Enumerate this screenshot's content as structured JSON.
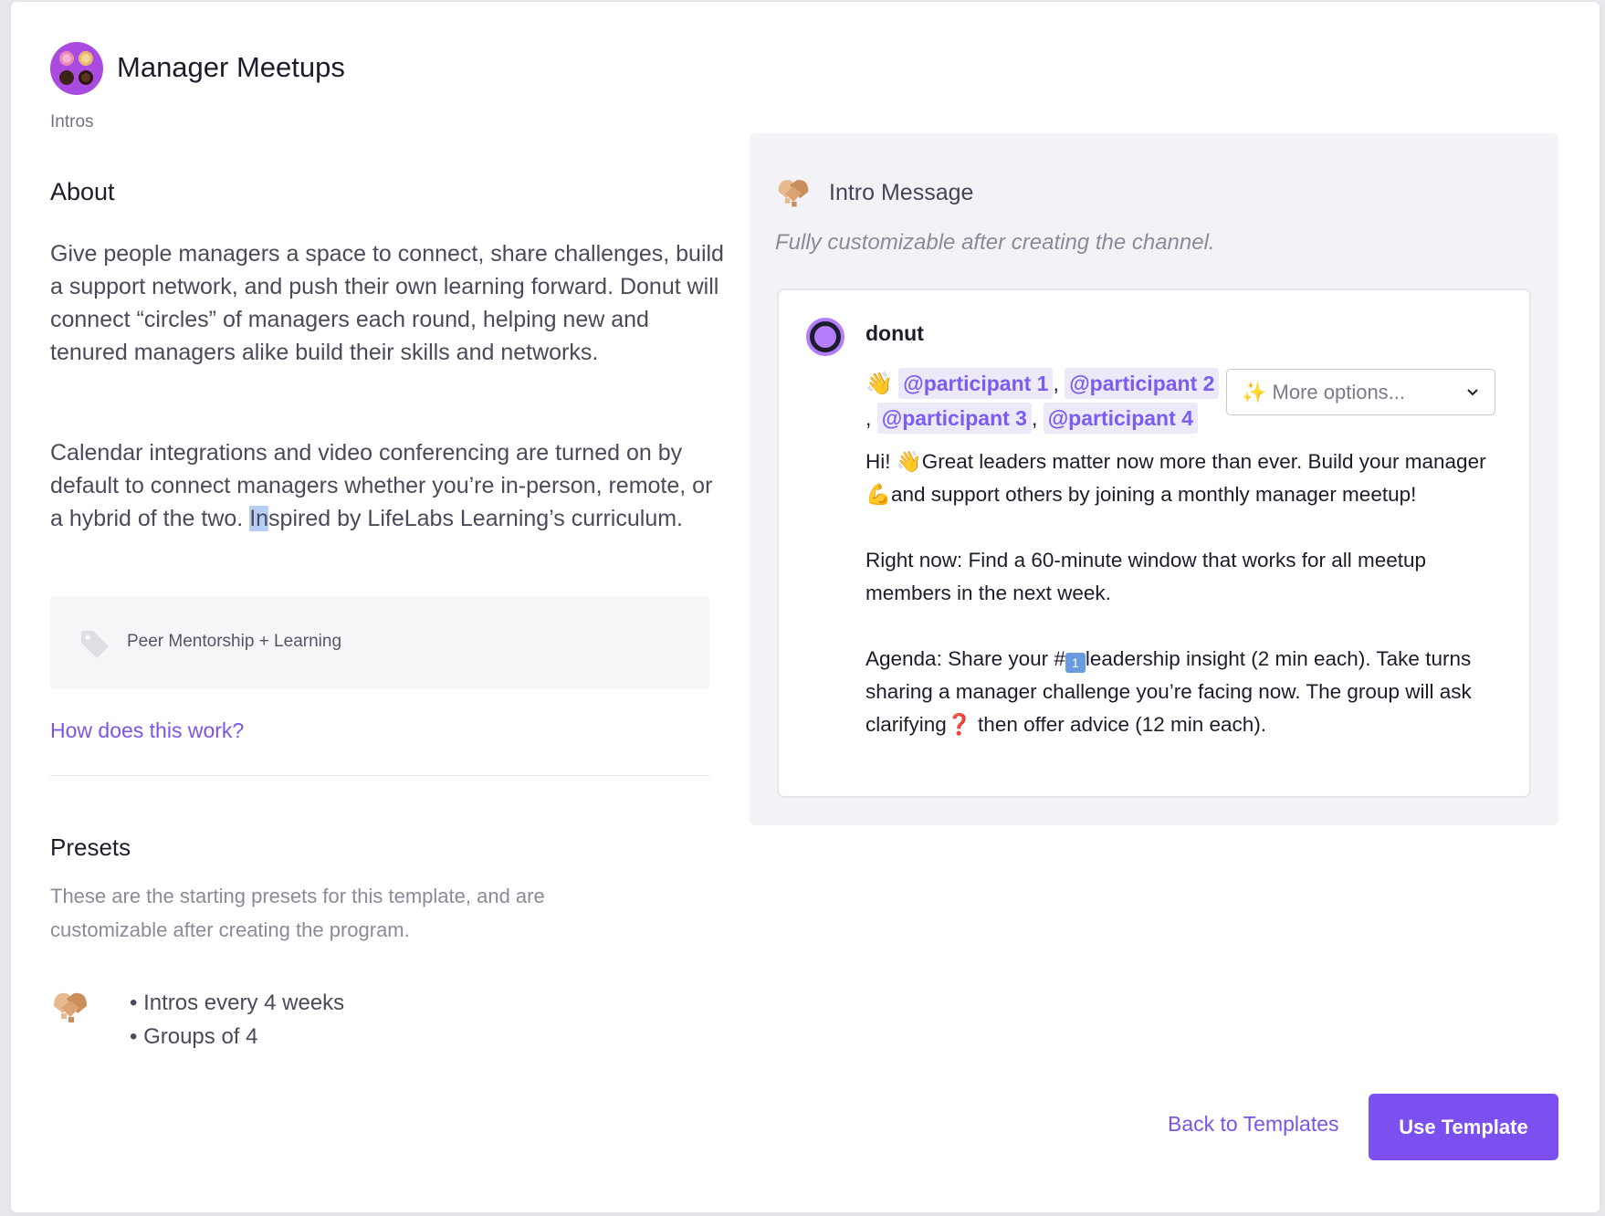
{
  "header": {
    "title": "Manager Meetups",
    "breadcrumb": "Intros"
  },
  "about": {
    "heading": "About",
    "paragraph1": "Give people managers a space to connect, share challenges, build a support network, and push their own learning forward. Donut will connect “circles” of managers each round, helping new and tenured managers alike build their skills and networks.",
    "paragraph2_a": "Calendar integrations and video conferencing are turned on by default to connect managers whether you’re in-person, remote, or a hybrid of the two. ",
    "paragraph2_cursor": "In",
    "paragraph2_b": "spired by LifeLabs Learning’s curriculum.",
    "tag": "Peer Mentorship + Learning",
    "tag_icon": "tag-icon",
    "how_link": "How does this work?"
  },
  "presets": {
    "heading": "Presets",
    "description": "These are the starting presets for this template, and are customizable after creating the program.",
    "icon": "handshake-icon",
    "item1_prefix": "• Intros ",
    "item1_bold": "every 4 weeks",
    "item2": "• Groups of 4"
  },
  "intro_panel": {
    "icon": "handshake-icon",
    "title": "Intro Message",
    "subtitle": "Fully customizable after creating the channel.",
    "bot_name": "donut",
    "wave": "👋",
    "mentions": [
      "@participant 1",
      "@participant 2",
      "@participant 3",
      "@participant 4"
    ],
    "separator": ",",
    "more_options": "✨ More options...",
    "msg1_a": "Hi! 👋Great leaders matter now more than ever. Build your manager ",
    "msg1_emoji": "💪",
    "msg1_b": "and support others by joining a monthly manager meetup!",
    "msg2": "Right now: Find a 60-minute window that works for all meetup members in the next week.",
    "msg3_a": "Agenda: Share your #",
    "msg3_key": "1",
    "msg3_b": "leadership insight (2 min each). Take turns sharing a manager challenge you’re facing now. The group will ask clarifying",
    "msg3_q": "❓",
    "msg3_c": " then offer advice (12 min each)."
  },
  "footer": {
    "back_label": "Back to Templates",
    "use_label": "Use Template"
  },
  "colors": {
    "accent": "#7c4ff0",
    "link": "#7b54e6",
    "mention_bg": "#eceaf9",
    "panel_bg": "#f3f3f7"
  }
}
